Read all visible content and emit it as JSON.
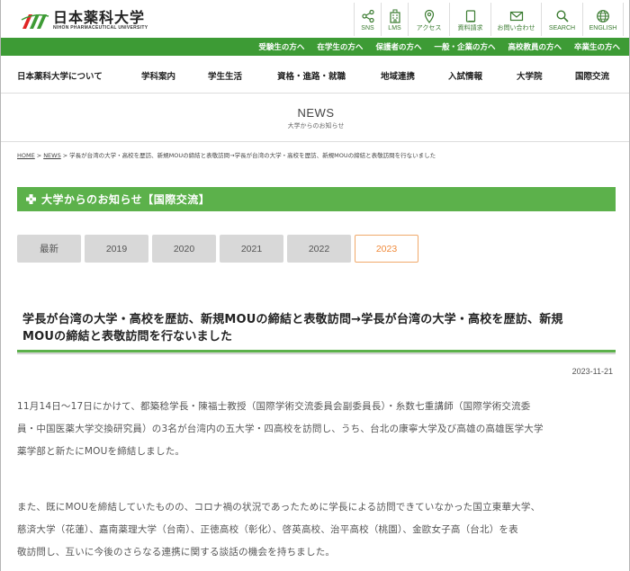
{
  "logo": {
    "jp": "日本薬科大学",
    "en": "NIHON PHARMACEUTICAL UNIVERSITY"
  },
  "util_nav": [
    {
      "label": "SNS",
      "icon": "share-icon"
    },
    {
      "label": "LMS",
      "icon": "building-icon"
    },
    {
      "label": "アクセス",
      "icon": "map-pin-icon"
    },
    {
      "label": "資料請求",
      "icon": "document-icon"
    },
    {
      "label": "お問い合わせ",
      "icon": "mail-icon"
    },
    {
      "label": "SEARCH",
      "icon": "search-icon"
    },
    {
      "label": "ENGLISH",
      "icon": "globe-icon"
    }
  ],
  "audience_nav": [
    "受験生の方へ",
    "在学生の方へ",
    "保護者の方へ",
    "一般・企業の方へ",
    "高校教員の方へ",
    "卒業生の方へ"
  ],
  "main_nav": [
    "日本薬科大学について",
    "学科案内",
    "学生生活",
    "資格・進路・就職",
    "地域連携",
    "入試情報",
    "大学院",
    "国際交流"
  ],
  "news_band": {
    "title": "NEWS",
    "subtitle": "大学からのお知らせ"
  },
  "breadcrumb": {
    "home": "HOME",
    "news": "NEWS",
    "current": "学長が台湾の大学・高校を歴訪、新規MOUの締結と表敬訪問→学長が台湾の大学・高校を歴訪、新規MOUの締結と表敬訪問を行ないました",
    "separator": ">"
  },
  "category": "大学からのお知らせ【国際交流】",
  "year_tabs": [
    {
      "label": "最新",
      "active": false
    },
    {
      "label": "2019",
      "active": false
    },
    {
      "label": "2020",
      "active": false
    },
    {
      "label": "2021",
      "active": false
    },
    {
      "label": "2022",
      "active": false
    },
    {
      "label": "2023",
      "active": true
    }
  ],
  "post": {
    "title_line1": "学長が台湾の大学・高校を歴訪、新規MOUの締結と表敬訪問→学長が台湾の大学・高校を歴訪、新規",
    "title_line2": "MOUの締結と表敬訪問を行ないました",
    "date": "2023-11-21",
    "p1_line1": "11月14日～17日にかけて、都築稔学長・陳福士教授（国際学術交流委員会副委員長）・糸数七重講師（国際学術交流委",
    "p1_line2": "員・中国医薬大学交換研究員）の3名が台湾内の五大学・四高校を訪問し、うち、台北の康寧大学及び高雄の高雄医学大学",
    "p1_line3": "薬学部と新たにMOUを締結しました。",
    "p2_line1": "また、既にMOUを締結していたものの、コロナ禍の状況であったために学長による訪問できていなかった国立東華大学、",
    "p2_line2": "慈済大学（花蓮）、嘉南薬理大学（台南）、正徳高校（彰化）、啓英高校、治平高校（桃園）、金歐女子高（台北）を表",
    "p2_line3": "敬訪問し、互いに今後のさらなる連携に関する談話の機会を持ちました。"
  },
  "colors": {
    "brand_green": "#3d9b35",
    "category_green": "#5cb14b",
    "active_tab": "#f08a3a"
  }
}
